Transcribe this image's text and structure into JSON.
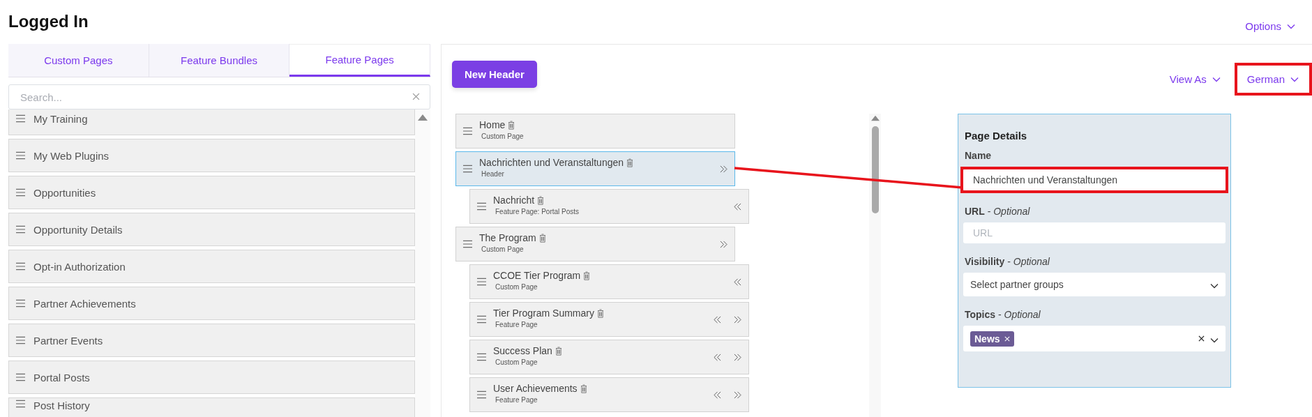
{
  "page_title": "Logged In",
  "options_menu": {
    "label": "Options"
  },
  "tabs": [
    {
      "label": "Custom Pages",
      "selected": false
    },
    {
      "label": "Feature Bundles",
      "selected": false
    },
    {
      "label": "Feature Pages",
      "selected": true
    }
  ],
  "search": {
    "placeholder": "Search..."
  },
  "feature_pages": [
    "My Training",
    "My Web Plugins",
    "Opportunities",
    "Opportunity Details",
    "Opt-in Authorization",
    "Partner Achievements",
    "Partner Events",
    "Portal Posts",
    "Post History"
  ],
  "toolbar": {
    "new_button": "New Header",
    "view_as": "View As",
    "language": {
      "label": "German",
      "highlighted": true
    }
  },
  "tree": [
    {
      "title": "Home",
      "subtitle": "Custom Page",
      "selected": false,
      "can_outdent": false,
      "can_indent": false
    },
    {
      "title": "Nachrichten und Veranstaltungen",
      "subtitle": "Header",
      "selected": true,
      "can_outdent": false,
      "can_indent": true,
      "children": [
        {
          "title": "Nachricht",
          "subtitle": "Feature Page: Portal Posts",
          "selected": false,
          "can_outdent": true,
          "can_indent": false
        }
      ]
    },
    {
      "title": "The Program",
      "subtitle": "Custom Page",
      "selected": false,
      "can_outdent": false,
      "can_indent": true,
      "children": [
        {
          "title": "CCOE Tier Program",
          "subtitle": "Custom Page",
          "selected": false,
          "can_outdent": true,
          "can_indent": false
        },
        {
          "title": "Tier Program Summary",
          "subtitle": "Feature Page",
          "selected": false,
          "can_outdent": true,
          "can_indent": true
        },
        {
          "title": "Success Plan",
          "subtitle": "Custom Page",
          "selected": false,
          "can_outdent": true,
          "can_indent": true
        },
        {
          "title": "User Achievements",
          "subtitle": "Feature Page",
          "selected": false,
          "can_outdent": true,
          "can_indent": true
        }
      ]
    }
  ],
  "details": {
    "heading": "Page Details",
    "fields": [
      {
        "kind": "text",
        "label": "**Name**",
        "value": "Nachrichten und Veranstaltungen",
        "highlighted": true
      },
      {
        "kind": "text",
        "label": "**URL** - *Optional*",
        "placeholder": "URL",
        "highlighted": false
      },
      {
        "kind": "select",
        "label": "**Visibility** - *Optional*",
        "placeholder": "Select partner groups",
        "highlighted": false
      },
      {
        "kind": "tags",
        "label": "**Topics** - *Optional*",
        "tags": [
          "News"
        ],
        "highlighted": false
      }
    ]
  }
}
